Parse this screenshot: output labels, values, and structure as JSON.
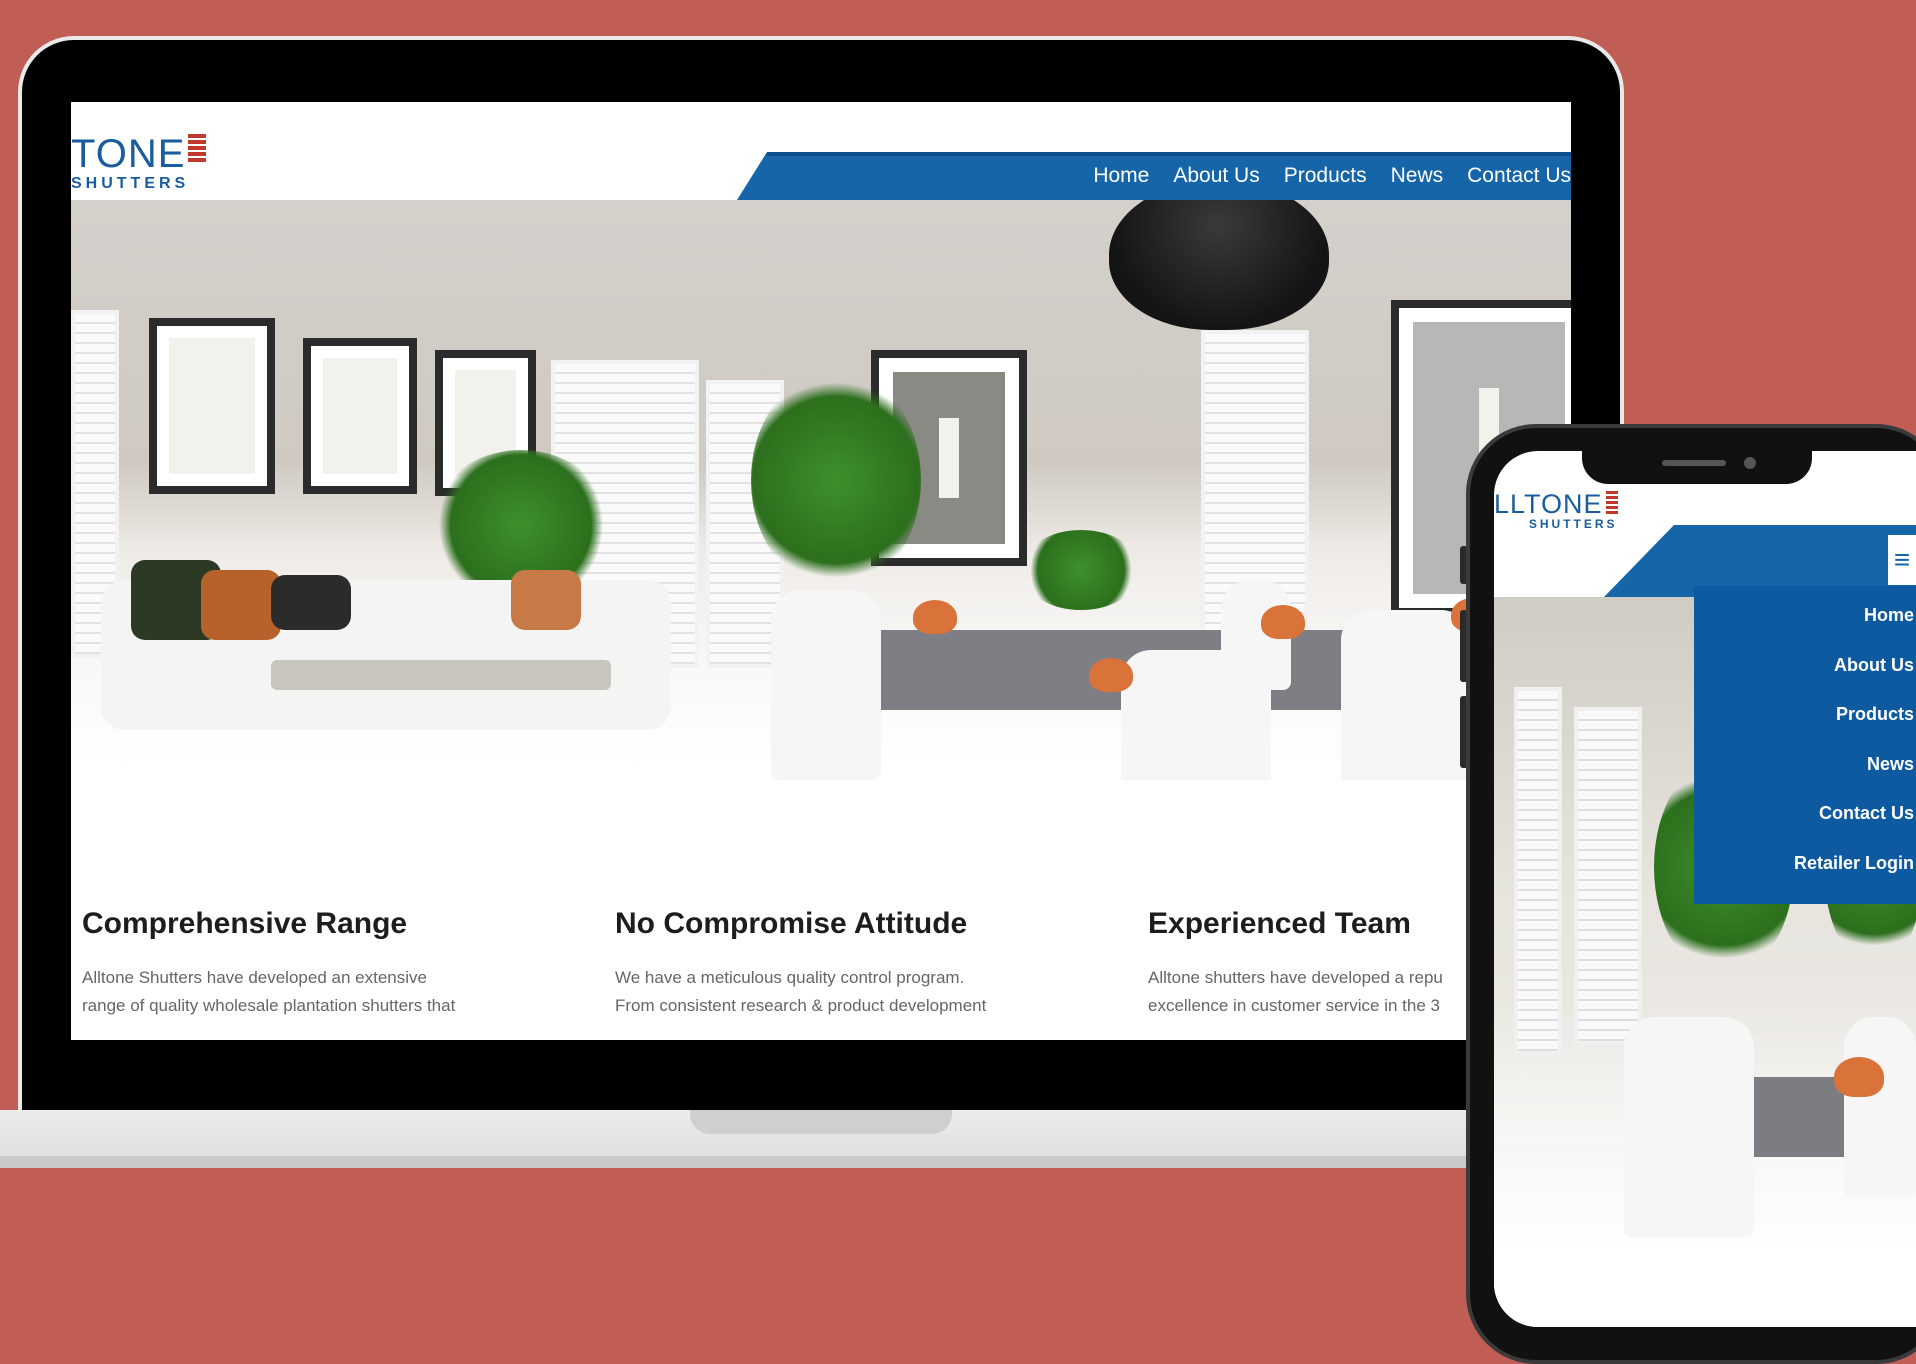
{
  "brand": {
    "desktop_logo_main": "TONE",
    "desktop_logo_sub": "SHUTTERS",
    "mobile_logo_main": "LLTONE",
    "mobile_logo_sub": "SHUTTERS",
    "primary_color": "#1565a8",
    "accent_color": "#c0392b",
    "background_color": "#c05e55"
  },
  "desktop": {
    "nav": [
      "Home",
      "About Us",
      "Products",
      "News",
      "Contact Us"
    ],
    "features": [
      {
        "title": "Comprehensive Range",
        "text_lines": [
          "Alltone Shutters have developed an extensive",
          "range of quality wholesale plantation shutters that"
        ]
      },
      {
        "title": "No Compromise Attitude",
        "text_lines": [
          "We have a meticulous quality control program.",
          "From consistent research & product development"
        ]
      },
      {
        "title": "Experienced Team",
        "text_lines": [
          "Alltone shutters have developed a repu",
          "excellence in customer service in the 3"
        ]
      }
    ]
  },
  "mobile": {
    "menu_icon": "hamburger-icon",
    "menu": [
      "Home",
      "About Us",
      "Products",
      "News",
      "Contact Us",
      "Retailer Login"
    ]
  }
}
